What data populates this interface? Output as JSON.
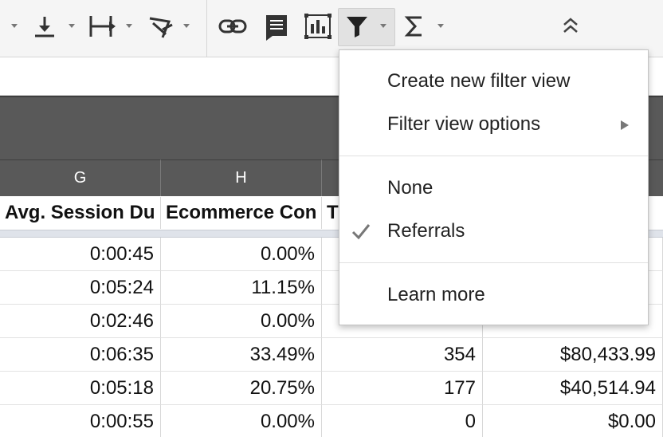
{
  "toolbar": {
    "icons": [
      "align-bottom-icon",
      "text-wrap-icon",
      "text-rotation-icon",
      "link-icon",
      "comment-icon",
      "chart-icon",
      "filter-icon",
      "functions-icon",
      "collapse-toolbar-icon"
    ]
  },
  "columns": [
    {
      "letter": "G",
      "header": "Avg. Session Du"
    },
    {
      "letter": "H",
      "header": "Ecommerce Con"
    },
    {
      "letter": "",
      "header": "T"
    },
    {
      "letter": "",
      "header": ""
    }
  ],
  "rows": [
    [
      "0:00:45",
      "0.00%",
      "",
      ""
    ],
    [
      "0:05:24",
      "11.15%",
      "",
      ""
    ],
    [
      "0:02:46",
      "0.00%",
      "",
      ""
    ],
    [
      "0:06:35",
      "33.49%",
      "354",
      "$80,433.99"
    ],
    [
      "0:05:18",
      "20.75%",
      "177",
      "$40,514.94"
    ],
    [
      "0:00:55",
      "0.00%",
      "0",
      "$0.00"
    ]
  ],
  "filter_menu": {
    "create_new": "Create new filter view",
    "options": "Filter view options",
    "none": "None",
    "referrals": "Referrals",
    "referrals_checked": true,
    "learn_more": "Learn more"
  }
}
